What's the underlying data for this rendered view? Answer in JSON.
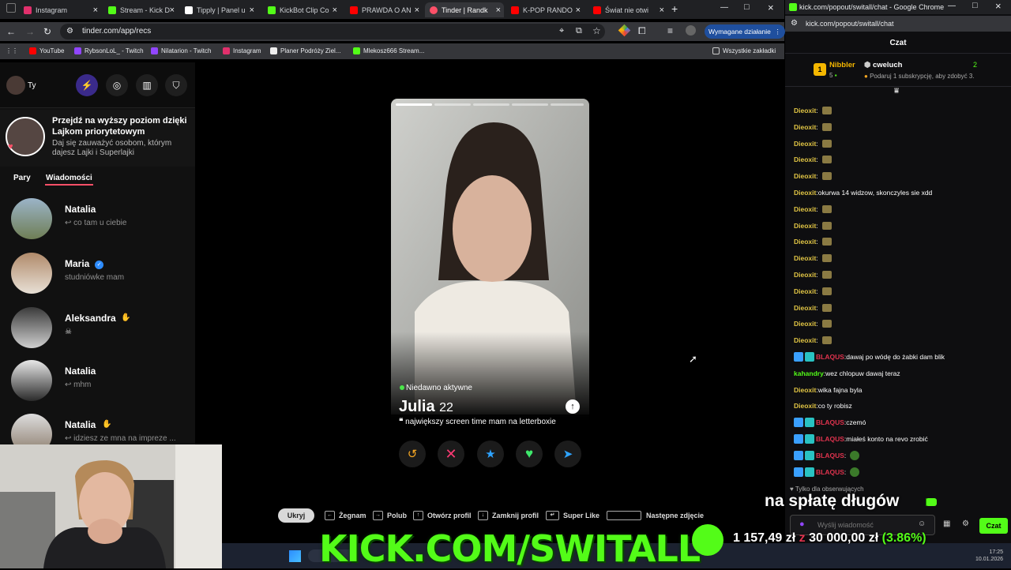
{
  "browser_left": {
    "tabs": [
      {
        "label": "Instagram",
        "color": "#e1306c"
      },
      {
        "label": "Stream - Kick D",
        "color": "#53fc18"
      },
      {
        "label": "Tipply | Panel u",
        "color": "#ffffff"
      },
      {
        "label": "KickBot Clip Co",
        "color": "#53fc18"
      },
      {
        "label": "PRAWDA O AN",
        "color": "#ff0000"
      },
      {
        "label": "Tinder | Randk",
        "color": "#fd5068"
      },
      {
        "label": "K-POP RANDO",
        "color": "#ff0000"
      },
      {
        "label": "Świat nie otwi",
        "color": "#ff0000"
      }
    ],
    "url": "tinder.com/app/recs",
    "action_button": "Wymagane działanie",
    "bookmarks": [
      "YouTube",
      "RybsonLoL_ - Twitch",
      "Nilatarion - Twitch",
      "Instagram",
      "Planer Podróży Ziel...",
      "Mlekosz666 Stream..."
    ],
    "bookmarks_all": "Wszystkie zakładki"
  },
  "tinder": {
    "profile_label": "Ty",
    "promo": {
      "title": "Przejdź na wyższy poziom dzięki Lajkom priorytetowym",
      "subtitle": "Daj się zauważyć osobom, którym dajesz Lajki i Superlajki"
    },
    "tabs": {
      "matches": "Pary",
      "messages": "Wiadomości"
    },
    "messages": [
      {
        "name": "Natalia",
        "preview": "↩ co tam u ciebie"
      },
      {
        "name": "Maria",
        "preview": "studniówke mam"
      },
      {
        "name": "Aleksandra",
        "preview": "☠"
      },
      {
        "name": "Natalia",
        "preview": "↩ mhm"
      },
      {
        "name": "Natalia",
        "preview": "↩ idziesz ze mna na impreze ..."
      }
    ],
    "card": {
      "status": "Niedawno aktywne",
      "name": "Julia",
      "age": "22",
      "bio": "największy screen time mam na letterboxie"
    },
    "shortcuts": {
      "hide": "Ukryj",
      "items": [
        "Żegnam",
        "Polub",
        "Otwórz profil",
        "Zamknij profil",
        "Super Like",
        "Następne zdjęcie"
      ]
    }
  },
  "chat_window": {
    "title": "kick.com/popout/switall/chat - Google Chrome",
    "url": "kick.com/popout/switall/chat",
    "header": "Czat",
    "gift": {
      "rank": "1",
      "top_user": "Nibbler",
      "top_count": "5",
      "user": "cweluch",
      "user_count": "2",
      "offer": "Podaruj 1 subskrypcję, aby zdobyć 3."
    },
    "messages": [
      {
        "user": "Dieoxit",
        "text": ""
      },
      {
        "user": "Dieoxit",
        "text": ""
      },
      {
        "user": "Dieoxit",
        "text": ""
      },
      {
        "user": "Dieoxit",
        "text": ""
      },
      {
        "user": "Dieoxit",
        "text": ""
      },
      {
        "user": "Dieoxit",
        "text": "okurwa 14 widzow, skonczyles sie xdd"
      },
      {
        "user": "Dieoxit",
        "text": ""
      },
      {
        "user": "Dieoxit",
        "text": ""
      },
      {
        "user": "Dieoxit",
        "text": ""
      },
      {
        "user": "Dieoxit",
        "text": ""
      },
      {
        "user": "Dieoxit",
        "text": ""
      },
      {
        "user": "Dieoxit",
        "text": ""
      },
      {
        "user": "Dieoxit",
        "text": ""
      },
      {
        "user": "Dieoxit",
        "text": ""
      },
      {
        "user": "Dieoxit",
        "text": ""
      },
      {
        "user": "BLAQUS",
        "text": "dawaj po wódę do żabki dam blik"
      },
      {
        "user": "kahandry",
        "text": "wez chlopuw dawaj teraz"
      },
      {
        "user": "Dieoxit",
        "text": "wika fajna byla"
      },
      {
        "user": "Dieoxit",
        "text": "co ty robisz"
      },
      {
        "user": "BLAQUS",
        "text": "czemó"
      },
      {
        "user": "BLAQUS",
        "text": "miałeś konto na revo zrobić"
      },
      {
        "user": "BLAQUS",
        "text": ""
      },
      {
        "user": "BLAQUS",
        "text": ""
      }
    ],
    "followers_only": "Tylko dla obserwujących",
    "input_placeholder": "Wyślij wiadomość",
    "send": "Czat"
  },
  "overlay": {
    "banner": "KICK.COM/SWITALL",
    "debt_title": "na spłatę długów",
    "debt_current": "1 157,49 zł",
    "debt_connector": "z",
    "debt_goal": "30 000,00 zł",
    "debt_percent": "(3.86%)",
    "progress": 0.0386
  },
  "colors": {
    "kick_green": "#53fc18",
    "tinder_red": "#fd5068",
    "chat_user": "#e2c645",
    "chat_red": "#e0334e",
    "chat_green": "#53fc18"
  }
}
